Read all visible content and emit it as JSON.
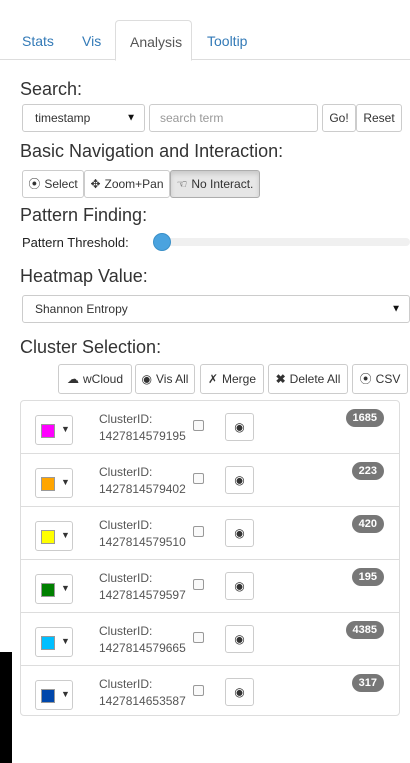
{
  "tabs": [
    {
      "label": "Stats"
    },
    {
      "label": "Vis"
    },
    {
      "label": "Analysis"
    },
    {
      "label": "Tooltip"
    }
  ],
  "active_tab": "Analysis",
  "search": {
    "heading": "Search:",
    "field_select": "timestamp",
    "placeholder": "search term",
    "go_label": "Go!",
    "reset_label": "Reset"
  },
  "navigation": {
    "heading": "Basic Navigation and Interaction:",
    "select_label": "Select",
    "zoom_label": "Zoom+Pan",
    "nointeract_label": "No Interact."
  },
  "pattern": {
    "heading": "Pattern Finding:",
    "threshold_label": "Pattern Threshold:",
    "threshold_value": 0.0
  },
  "heatmap": {
    "heading": "Heatmap Value:",
    "selected": "Shannon Entropy"
  },
  "clusters": {
    "heading": "Cluster Selection:",
    "wcloud_label": "wCloud",
    "visall_label": "Vis All",
    "merge_label": "Merge",
    "deleteall_label": "Delete All",
    "csv_label": "CSV",
    "id_prefix": "ClusterID:",
    "items": [
      {
        "id": "1427814579195",
        "count": "1685",
        "color": "#ff00ff"
      },
      {
        "id": "1427814579402",
        "count": "223",
        "color": "#ffa500"
      },
      {
        "id": "1427814579510",
        "count": "420",
        "color": "#ffff00"
      },
      {
        "id": "1427814579597",
        "count": "195",
        "color": "#008000"
      },
      {
        "id": "1427814579665",
        "count": "4385",
        "color": "#00bfff"
      },
      {
        "id": "1427814653587",
        "count": "317",
        "color": "#0047ab"
      }
    ]
  }
}
